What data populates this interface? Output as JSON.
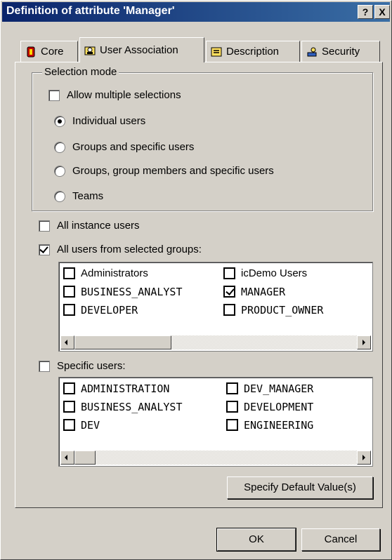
{
  "window": {
    "title": "Definition of attribute 'Manager'",
    "help_label": "?",
    "close_label": "X"
  },
  "tabs": [
    {
      "label": "Core",
      "icon": "core-icon"
    },
    {
      "label": "User Association",
      "icon": "user-association-icon",
      "active": true
    },
    {
      "label": "Description",
      "icon": "description-icon"
    },
    {
      "label": "Security",
      "icon": "security-icon"
    }
  ],
  "selection_mode": {
    "legend": "Selection mode",
    "allow_multiple": {
      "label": "Allow multiple selections",
      "checked": false
    },
    "options": [
      {
        "label": "Individual users",
        "selected": true
      },
      {
        "label": "Groups and specific users",
        "selected": false
      },
      {
        "label": "Groups, group members and specific users",
        "selected": false
      },
      {
        "label": "Teams",
        "selected": false
      }
    ]
  },
  "all_instance_users": {
    "label": "All instance users",
    "checked": false
  },
  "all_users_from_groups": {
    "label": "All users from selected groups:",
    "checked": true,
    "items": [
      {
        "label": "Administrators",
        "checked": false
      },
      {
        "label": "icDemo Users",
        "checked": false
      },
      {
        "label": "BUSINESS_ANALYST",
        "checked": false
      },
      {
        "label": "MANAGER",
        "checked": true
      },
      {
        "label": "DEVELOPER",
        "checked": false
      },
      {
        "label": "PRODUCT_OWNER",
        "checked": false
      }
    ]
  },
  "specific_users": {
    "label": "Specific users:",
    "checked": false,
    "items": [
      {
        "label": "ADMINISTRATION",
        "checked": false
      },
      {
        "label": "DEV_MANAGER",
        "checked": false
      },
      {
        "label": "BUSINESS_ANALYST",
        "checked": false
      },
      {
        "label": "DEVELOPMENT",
        "checked": false
      },
      {
        "label": "DEV",
        "checked": false
      },
      {
        "label": "ENGINEERING",
        "checked": false
      }
    ]
  },
  "buttons": {
    "specify_default": "Specify Default Value(s)",
    "ok": "OK",
    "cancel": "Cancel"
  }
}
